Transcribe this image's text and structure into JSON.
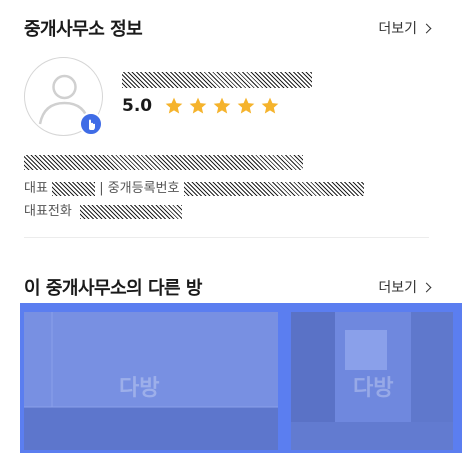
{
  "agency": {
    "title": "중개사무소 정보",
    "more_label": "더보기",
    "rating": "5.0",
    "star_count": 5,
    "star_color": "#f5b32c",
    "badge_color": "#3f6ce6",
    "rep_label": "대표",
    "reg_label": "| 중개등록번호",
    "phone_label": "대표전화"
  },
  "other_rooms": {
    "title": "이 중개사무소의 다른 방",
    "more_label": "더보기",
    "watermark": "다방",
    "overlay_color": "#5b7ef0"
  },
  "icons": [
    "user-avatar-icon",
    "touch-icon",
    "star-icon",
    "chevron-right-icon"
  ]
}
